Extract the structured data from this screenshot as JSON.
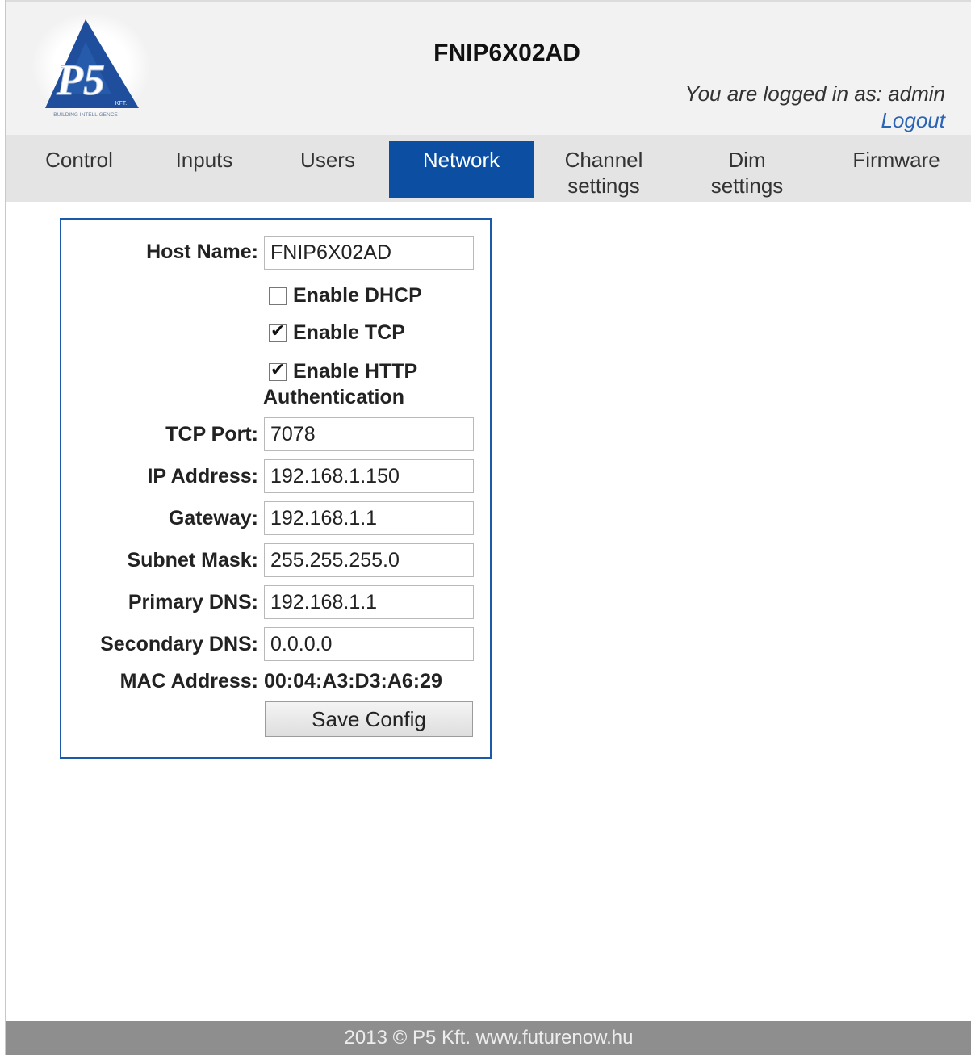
{
  "header": {
    "logo_text": "P5",
    "logo_sub": "KFT.",
    "logo_tagline": "BUILDING INTELLIGENCE",
    "device_name": "FNIP6X02AD",
    "login_text": "You are logged in as: admin",
    "logout_label": "Logout"
  },
  "nav": {
    "items": [
      {
        "label": "Control"
      },
      {
        "label": "Inputs"
      },
      {
        "label": "Users"
      },
      {
        "label": "Network",
        "active": true
      },
      {
        "label": "Channel settings"
      },
      {
        "label": "Dim settings"
      },
      {
        "label": "Firmware"
      }
    ]
  },
  "form": {
    "host_name_label": "Host Name:",
    "host_name_value": "FNIP6X02AD",
    "dhcp_label": "Enable DHCP",
    "dhcp_checked": false,
    "tcp_label": "Enable TCP",
    "tcp_checked": true,
    "http_auth_label_1": "Enable HTTP",
    "http_auth_label_2": "Authentication",
    "http_auth_checked": true,
    "tcp_port_label": "TCP Port:",
    "tcp_port_value": "7078",
    "ip_label": "IP Address:",
    "ip_value": "192.168.1.150",
    "gateway_label": "Gateway:",
    "gateway_value": "192.168.1.1",
    "subnet_label": "Subnet Mask:",
    "subnet_value": "255.255.255.0",
    "primary_dns_label": "Primary DNS:",
    "primary_dns_value": "192.168.1.1",
    "secondary_dns_label": "Secondary DNS:",
    "secondary_dns_value": "0.0.0.0",
    "mac_label": "MAC Address:",
    "mac_value": "00:04:A3:D3:A6:29",
    "save_label": "Save Config"
  },
  "footer": {
    "text": "2013 © P5 Kft. www.futurenow.hu"
  },
  "colors": {
    "accent": "#0c4ea2",
    "link": "#2a64b4",
    "footer_bg": "#8e8e8e"
  }
}
